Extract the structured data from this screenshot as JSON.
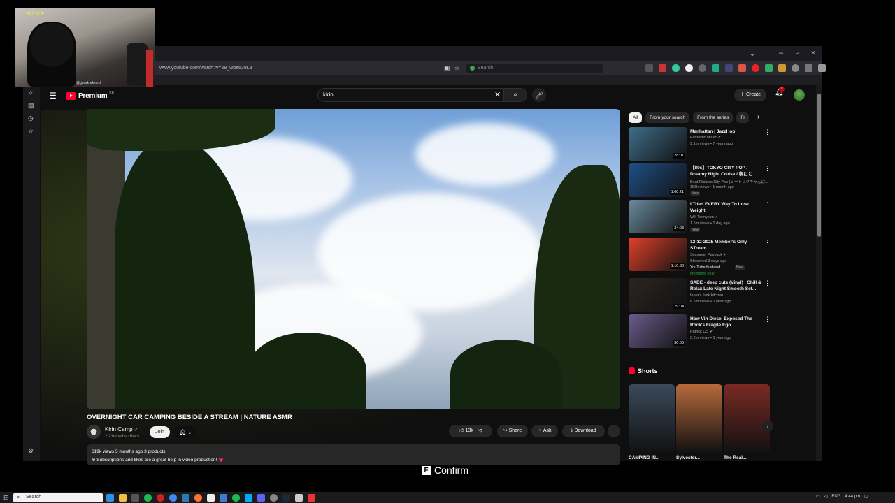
{
  "webcam": {
    "tag": "<☆☆>",
    "handle": "@gmwkrekkord"
  },
  "browser": {
    "url": "www.youtube.com/watch?v=28_wbe638L8",
    "search_placeholder": "Search"
  },
  "youtube": {
    "logo_text": "Premium",
    "logo_sup": "KE",
    "search_query": "kirin",
    "create_label": "Create",
    "notif_count": "9"
  },
  "video": {
    "title": "OVERNIGHT CAR CAMPING BESIDE A STREAM | NATURE ASMR",
    "channel": "Kirin Camp",
    "subscribers": "2.21m subscribers",
    "join_label": "Join",
    "likes": "13k",
    "share_label": "Share",
    "ask_label": "Ask",
    "download_label": "Download",
    "description_stats": "619k views  5 months ago  3 products",
    "description_line": "※ Subscriptions and likes are a great help in video production! 💗"
  },
  "chips": [
    "All",
    "From your search",
    "From the series",
    "Fr"
  ],
  "recommendations": [
    {
      "title": "Manhattan | JazzHop",
      "channel": "Fantastic Music ✔",
      "meta": "9.1m views • 7 years ago",
      "duration": "28:01",
      "thumb_color": "#3f6e8a"
    },
    {
      "title": "【80s】TOKYO CITY POP / Dreamy Night Cruise / 夜にと...",
      "channel": "Beat Flickers City Pop (ビートリクキャんぱ...",
      "meta": "106k views • 1 month ago",
      "badge": "New",
      "duration": "1:00:21",
      "thumb_color": "#1f4f86"
    },
    {
      "title": "I Tried EVERY Way To Lose Weight",
      "channel": "Will Tennyson ✔",
      "meta": "1.5m views • 1 day ago",
      "badge": "New",
      "duration": "34:03",
      "thumb_color": "#6b8a9e"
    },
    {
      "title": "12-12-2025 Member's Only STream",
      "channel": "Scammer Payback ✔",
      "meta": "Streamed 3 days ago",
      "extra": "YouTube featured",
      "badge": "New",
      "members": "Members only",
      "duration": "1:10:38",
      "thumb_color": "#e0412b"
    },
    {
      "title": "SADE - deep cuts (Vinyl) | Chill & Relax Late Night Smooth Set...",
      "channel": "taner's funk kitchen",
      "meta": "6.6m views • 1 year ago",
      "duration": "29:04",
      "thumb_color": "#2a2522"
    },
    {
      "title": "How Vin Diesel Exposed The Rock's Fragile Ego",
      "channel": "Patrick Cc: ✔",
      "meta": "3.2m views • 1 year ago",
      "duration": "30:00",
      "thumb_color": "#6a5c8a"
    }
  ],
  "shorts": {
    "header": "Shorts",
    "items": [
      {
        "title": "CAMPING IN...",
        "color": "#3a4a5a"
      },
      {
        "title": "Sylvester...",
        "color": "#b86a3c"
      },
      {
        "title": "The Real...",
        "color": "#7a2a24"
      }
    ]
  },
  "confirm": {
    "key": "F",
    "label": "Confirm"
  },
  "taskbar": {
    "search_placeholder": "Search",
    "lang": "ENG",
    "time": "4:44 pm"
  }
}
